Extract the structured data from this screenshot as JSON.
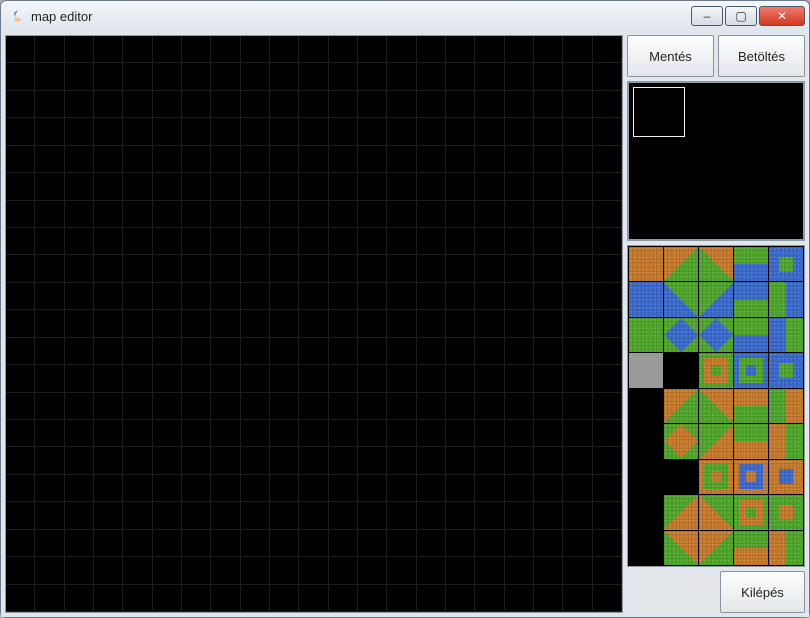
{
  "window": {
    "title": "map editor",
    "controls": {
      "minimize": "–",
      "maximize": "▢",
      "close": "✕"
    }
  },
  "canvas": {
    "grid_cols": 21,
    "grid_rows": 21
  },
  "sidebar": {
    "buttons": {
      "save": "Mentés",
      "load": "Betöltés",
      "exit": "Kilépés"
    },
    "preview": {
      "selected_index": 0
    },
    "palette": {
      "cols": 5,
      "rows": 9,
      "tiles": [
        {
          "bg": "orange",
          "shape": "solid"
        },
        {
          "bg": "green",
          "shape": "tri-tl",
          "fg": "orange"
        },
        {
          "bg": "green",
          "shape": "tri-tr",
          "fg": "orange"
        },
        {
          "bg": "blue",
          "shape": "half-top",
          "fg": "green"
        },
        {
          "bg": "blue",
          "shape": "center-sq",
          "fg": "green"
        },
        {
          "bg": "blue",
          "shape": "solid"
        },
        {
          "bg": "green",
          "shape": "tri-bl",
          "fg": "blue"
        },
        {
          "bg": "green",
          "shape": "tri-br",
          "fg": "blue"
        },
        {
          "bg": "green",
          "shape": "half-top",
          "fg": "blue"
        },
        {
          "bg": "green",
          "shape": "half-right",
          "fg": "blue"
        },
        {
          "bg": "green",
          "shape": "solid"
        },
        {
          "bg": "green",
          "shape": "diamond",
          "fg": "blue"
        },
        {
          "bg": "green",
          "shape": "diamond",
          "fg": "blue"
        },
        {
          "bg": "green",
          "shape": "half-bot",
          "fg": "blue"
        },
        {
          "bg": "green",
          "shape": "half-left",
          "fg": "blue"
        },
        {
          "bg": "gray",
          "shape": "solid"
        },
        {
          "bg": "black",
          "shape": "solid"
        },
        {
          "bg": "green",
          "shape": "ring",
          "fg": "orange"
        },
        {
          "bg": "blue",
          "shape": "ring",
          "fg": "green"
        },
        {
          "bg": "blue",
          "shape": "center-sq",
          "fg": "green"
        },
        {
          "bg": "black",
          "shape": "solid"
        },
        {
          "bg": "green",
          "shape": "tri-tl",
          "fg": "orange"
        },
        {
          "bg": "green",
          "shape": "tri-tr",
          "fg": "orange"
        },
        {
          "bg": "green",
          "shape": "half-top",
          "fg": "orange"
        },
        {
          "bg": "green",
          "shape": "half-right",
          "fg": "orange"
        },
        {
          "bg": "black",
          "shape": "solid"
        },
        {
          "bg": "green",
          "shape": "diamond",
          "fg": "orange"
        },
        {
          "bg": "green",
          "shape": "tri-br",
          "fg": "orange"
        },
        {
          "bg": "green",
          "shape": "half-bot",
          "fg": "orange"
        },
        {
          "bg": "green",
          "shape": "half-left",
          "fg": "orange"
        },
        {
          "bg": "black",
          "shape": "solid"
        },
        {
          "bg": "black",
          "shape": "solid"
        },
        {
          "bg": "orange",
          "shape": "ring",
          "fg": "green"
        },
        {
          "bg": "orange",
          "shape": "ring",
          "fg": "blue"
        },
        {
          "bg": "orange",
          "shape": "center-sq",
          "fg": "blue"
        },
        {
          "bg": "black",
          "shape": "solid"
        },
        {
          "bg": "orange",
          "shape": "tri-tl",
          "fg": "green"
        },
        {
          "bg": "orange",
          "shape": "tri-tr",
          "fg": "green"
        },
        {
          "bg": "green",
          "shape": "ring",
          "fg": "orange"
        },
        {
          "bg": "green",
          "shape": "center-sq",
          "fg": "orange"
        },
        {
          "bg": "black",
          "shape": "solid"
        },
        {
          "bg": "orange",
          "shape": "tri-bl",
          "fg": "green"
        },
        {
          "bg": "orange",
          "shape": "tri-br",
          "fg": "green"
        },
        {
          "bg": "orange",
          "shape": "half-top",
          "fg": "green"
        },
        {
          "bg": "orange",
          "shape": "half-right",
          "fg": "green"
        }
      ]
    }
  }
}
